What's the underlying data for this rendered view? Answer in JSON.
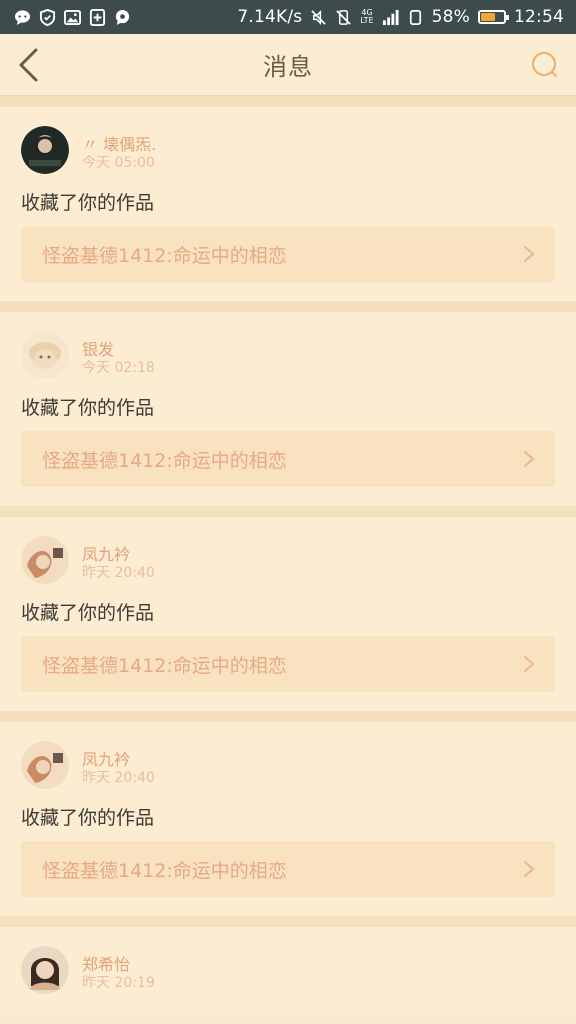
{
  "status_bar": {
    "speed": "7.14K/s",
    "net_type": "4G",
    "net_sub": "LTE",
    "battery_pct": "58%",
    "battery_level": 0.58,
    "time": "12:54",
    "colors": {
      "background": "#3d4c4a",
      "battery_fill": "#f0a830"
    },
    "left_icons": [
      "chat-icon",
      "shield-icon",
      "image-icon",
      "plus-square-icon",
      "location-chat-icon"
    ],
    "right_icons": [
      "mute-icon",
      "vibrate-off-icon",
      "signal-icon",
      "tablet-icon",
      "battery-icon"
    ]
  },
  "header": {
    "title": "消息",
    "back_icon": "chevron-left-icon",
    "search_icon": "search-icon"
  },
  "messages": [
    {
      "username": "〃 壊偶炁.",
      "time": "今天 05:00",
      "action": "收藏了你的作品",
      "work_title": "怪盗基德1412:命运中的相恋"
    },
    {
      "username": "银发",
      "time": "今天 02:18",
      "action": "收藏了你的作品",
      "work_title": "怪盗基德1412:命运中的相恋"
    },
    {
      "username": "凤九衿",
      "time": "昨天 20:40",
      "action": "收藏了你的作品",
      "work_title": "怪盗基德1412:命运中的相恋"
    },
    {
      "username": "凤九衿",
      "time": "昨天 20:40",
      "action": "收藏了你的作品",
      "work_title": "怪盗基德1412:命运中的相恋"
    },
    {
      "username": "郑希怡",
      "time": "昨天 20:19"
    }
  ],
  "colors": {
    "page_bg": "#f7e8cd",
    "card_bg": "#fcecd2",
    "link_bg": "#f9e2c0",
    "accent": "#e8a884",
    "username": "#e0a37a"
  }
}
